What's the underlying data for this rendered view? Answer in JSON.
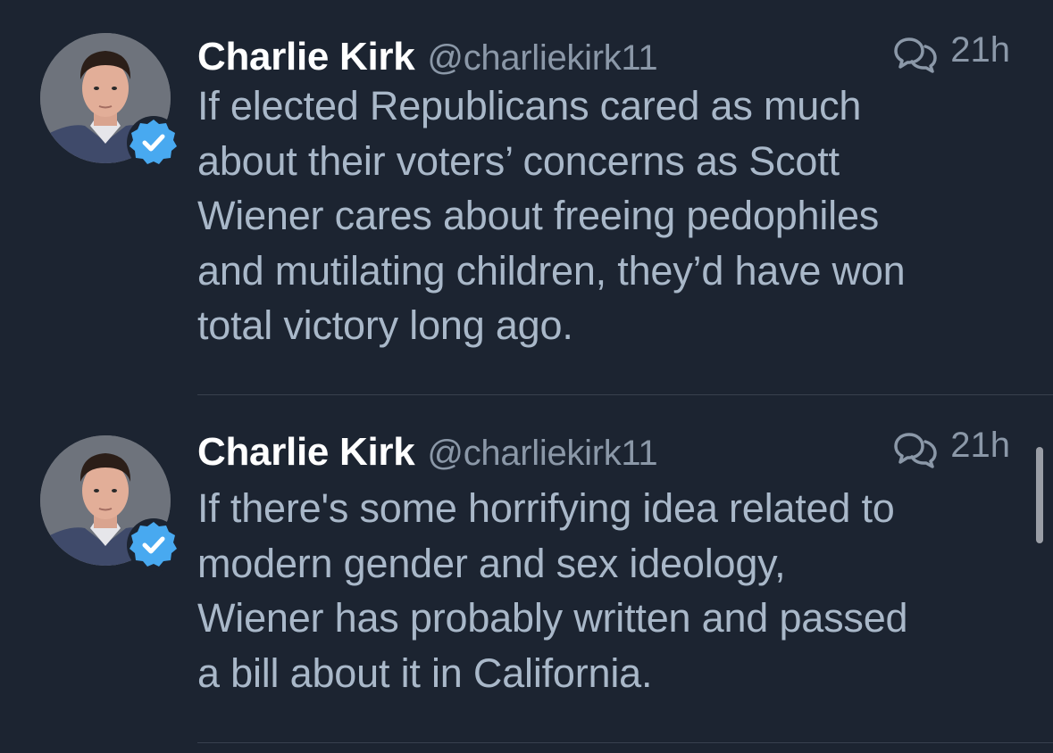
{
  "colors": {
    "background": "#1c2431",
    "name": "#ffffff",
    "secondary_text": "#8b98a8",
    "body_text": "#a9b8c9",
    "verified_badge": "#48a9f0",
    "divider": "#38404e"
  },
  "tweets": [
    {
      "name": "Charlie Kirk",
      "handle": "@charliekirk11",
      "time": "21h",
      "verified": true,
      "icon": "conversation-icon",
      "text": "If elected Republicans cared as much\nabout their voters’ concerns as Scott\nWiener cares about freeing pedophiles\nand mutilating children, they’d have won\ntotal victory long ago."
    },
    {
      "name": "Charlie Kirk",
      "handle": "@charliekirk11",
      "time": "21h",
      "verified": true,
      "icon": "conversation-icon",
      "text": "If there's some horrifying idea related to\nmodern gender and sex ideology,\nWiener has probably written and passed\na bill about it in California."
    }
  ]
}
